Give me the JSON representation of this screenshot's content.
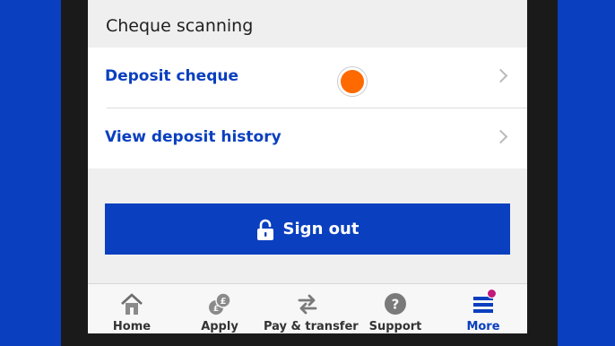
{
  "section": {
    "title": "Cheque scanning"
  },
  "list": {
    "items": [
      {
        "label": "Deposit cheque"
      },
      {
        "label": "View deposit history"
      }
    ]
  },
  "signout": {
    "label": "Sign out",
    "icon": "padlock-open-icon"
  },
  "tabbar": {
    "items": [
      {
        "label": "Home",
        "icon": "house-icon"
      },
      {
        "label": "Apply",
        "icon": "coins-icon"
      },
      {
        "label": "Pay & transfer",
        "icon": "transfer-arrows-icon"
      },
      {
        "label": "Support",
        "icon": "question-icon"
      },
      {
        "label": "More",
        "icon": "menu-icon",
        "active": true
      }
    ]
  },
  "colors": {
    "brand_blue": "#0a3fbf",
    "touch_indicator": "#ff6a00",
    "notification": "#c2187a"
  }
}
